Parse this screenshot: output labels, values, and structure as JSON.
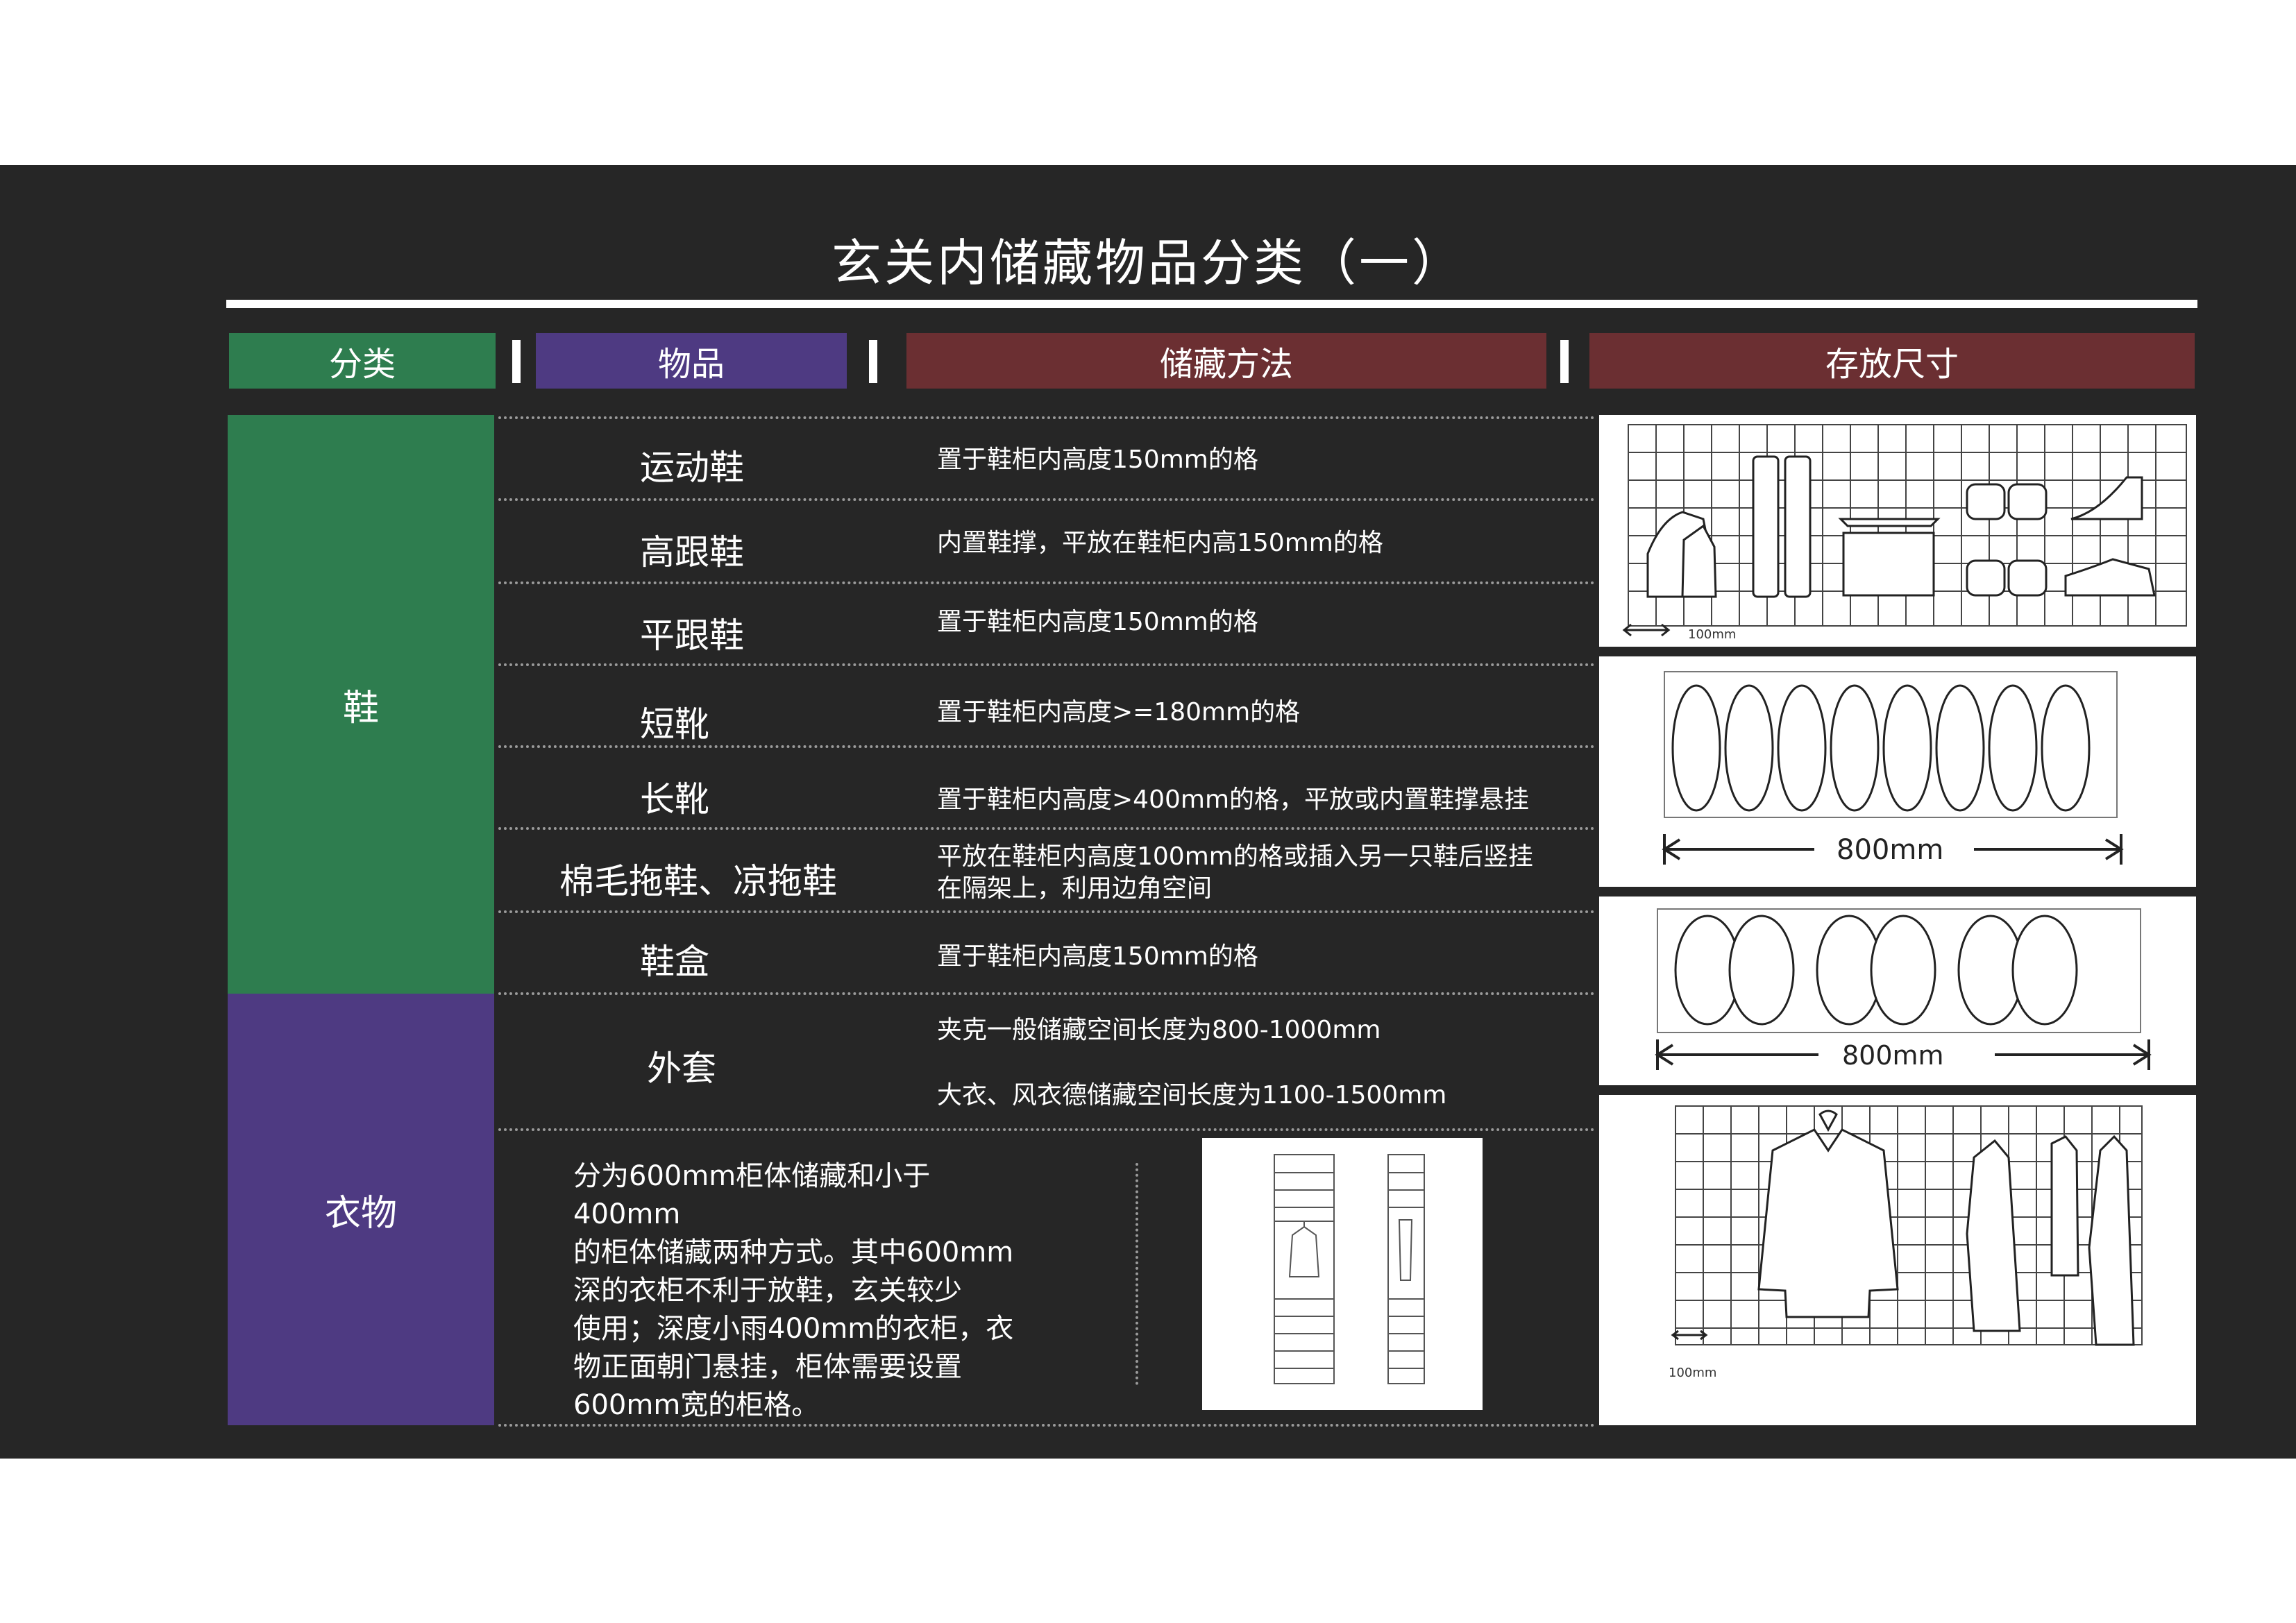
{
  "title": "玄关内储藏物品分类（一）",
  "headers": {
    "category": "分类",
    "item": "物品",
    "method": "储藏方法",
    "size": "存放尺寸"
  },
  "colors": {
    "green": "#2e7d4f",
    "purple": "#4e3a82",
    "red": "#6b2f32",
    "background": "#262626"
  },
  "categories": {
    "shoes": "鞋",
    "clothes": "衣物"
  },
  "shoes": [
    {
      "item": "运动鞋",
      "method": "置于鞋柜内高度150mm的格"
    },
    {
      "item": "高跟鞋",
      "method": "内置鞋撑，平放在鞋柜内高150mm的格"
    },
    {
      "item": "平跟鞋",
      "method": "置于鞋柜内高度150mm的格"
    },
    {
      "item": "短靴",
      "method": "置于鞋柜内高度>=180mm的格"
    },
    {
      "item": "长靴",
      "method": "置于鞋柜内高度>400mm的格，平放或内置鞋撑悬挂"
    },
    {
      "item": "棉毛拖鞋、凉拖鞋",
      "method_line1": "平放在鞋柜内高度100mm的格或插入另一只鞋后竖挂",
      "method_line2": "在隔架上，利用边角空间"
    },
    {
      "item": "鞋盒",
      "method": "置于鞋柜内高度150mm的格"
    }
  ],
  "clothes": {
    "item": "外套",
    "method_line1": "夹克一般储藏空间长度为800-1000mm",
    "method_line2": "大衣、风衣德储藏空间长度为1100-1500mm",
    "paragraph": [
      "分为600mm柜体储藏和小于400mm",
      "的柜体储藏两种方式。其中600mm",
      "深的衣柜不利于放鞋，玄关较少",
      "使用；深度小雨400mm的衣柜，衣",
      "物正面朝门悬挂，柜体需要设置",
      "600mm宽的柜格。"
    ]
  },
  "size_images": {
    "shoe_grid_scale": "100mm",
    "flats_width": "800mm",
    "slippers_width": "800mm",
    "coat_grid_scale": "100mm"
  }
}
